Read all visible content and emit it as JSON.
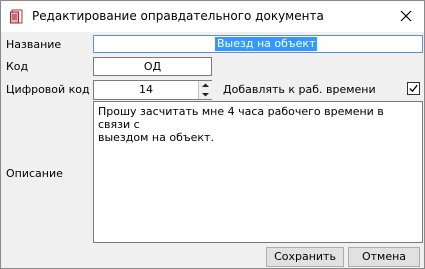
{
  "window": {
    "title": "Редактирование оправдательного документа",
    "app_icon": "document-icon",
    "close_icon": "close-icon"
  },
  "form": {
    "name_label": "Название",
    "name_value": "Выезд на объект",
    "code_label": "Код",
    "code_value": "ОД",
    "digital_code_label": "Цифровой код",
    "digital_code_value": "14",
    "add_to_work_time_label": "Добавлять к раб. времени",
    "add_to_work_time_checked": true,
    "description_label": "Описание",
    "description_value": "Прошу засчитать мне 4 часа рабочего времени в связи с\nвыездом на объект."
  },
  "buttons": {
    "save_label": "Сохранить",
    "cancel_label": "Отмена"
  },
  "colors": {
    "selection": "#3399ff",
    "focus_border": "#5b8fd6",
    "dialog_background": "#f0f0f0"
  }
}
